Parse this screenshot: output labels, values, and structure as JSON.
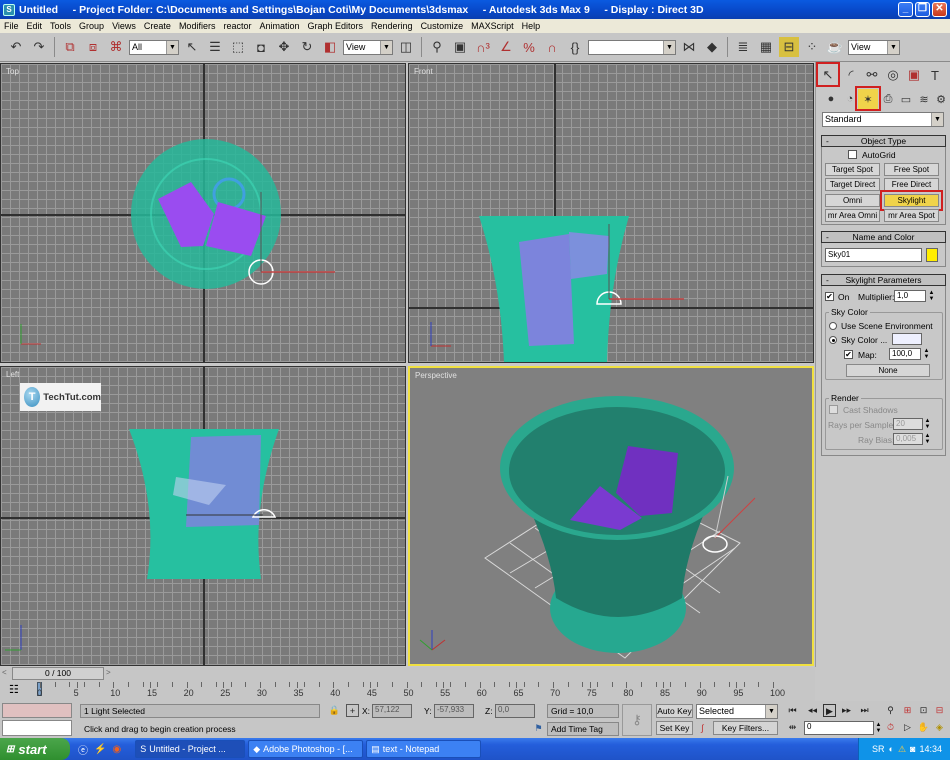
{
  "window": {
    "title": "Untitled     - Project Folder: C:\\Documents and Settings\\Bojan Coti\\My Documents\\3dsmax     - Autodesk 3ds Max 9     - Display : Direct 3D",
    "controls": {
      "minimize": "_",
      "maximize": "❐",
      "close": "✕"
    }
  },
  "menu": [
    "File",
    "Edit",
    "Tools",
    "Group",
    "Views",
    "Create",
    "Modifiers",
    "reactor",
    "Animation",
    "Graph Editors",
    "Rendering",
    "Customize",
    "MAXScript",
    "Help"
  ],
  "toolbar": {
    "selection_filter": "All",
    "reference_coord": "View",
    "named_selection": "",
    "render_view": "View"
  },
  "viewports": [
    {
      "label": "Top",
      "active": false
    },
    {
      "label": "Front",
      "active": false
    },
    {
      "label": "Left",
      "active": false
    },
    {
      "label": "Perspective",
      "active": true
    }
  ],
  "watermark": "TechTut.com",
  "command_panel": {
    "category": "Standard",
    "object_type": {
      "title": "Object Type",
      "autogrid_label": "AutoGrid",
      "autogrid_checked": false,
      "buttons": [
        "Target Spot",
        "Free Spot",
        "Target Direct",
        "Free Direct",
        "Omni",
        "Skylight",
        "mr Area Omni",
        "mr Area Spot"
      ],
      "active": "Skylight"
    },
    "name_color": {
      "title": "Name and Color",
      "name": "Sky01",
      "color": "#ffee00"
    },
    "skylight_params": {
      "title": "Skylight Parameters",
      "on_label": "On",
      "on_checked": true,
      "multiplier_label": "Multiplier:",
      "multiplier": "1,0",
      "sky_color_group": "Sky Color",
      "use_scene_env": "Use Scene Environment",
      "sky_color_label": "Sky Color ...",
      "sky_color_selected": true,
      "sky_color_swatch": "#eef0ff",
      "map_label": "Map:",
      "map_checked": true,
      "map_value": "100,0",
      "map_button": "None",
      "render_group": "Render",
      "cast_shadows": "Cast Shadows",
      "rays_label": "Rays per Sample:",
      "rays_value": "20",
      "ray_bias_label": "Ray Bias:",
      "ray_bias_value": "0,005"
    }
  },
  "timeline": {
    "frame_display": "0 / 100",
    "prev": "<",
    "next": ">",
    "ticks": [
      "0",
      "5",
      "10",
      "15",
      "20",
      "25",
      "30",
      "35",
      "40",
      "45",
      "50",
      "55",
      "60",
      "65",
      "70",
      "75",
      "80",
      "85",
      "90",
      "95",
      "100"
    ]
  },
  "status": {
    "selection": "1 Light Selected",
    "prompt": "Click and drag to begin creation process",
    "x_label": "X:",
    "x": "57,122",
    "y_label": "Y:",
    "y": "-57,933",
    "z_label": "Z:",
    "z": "0,0",
    "grid": "Grid = 10,0",
    "add_time_tag": "Add Time Tag",
    "auto_key": "Auto Key",
    "set_key": "Set Key",
    "key_mode": "Selected",
    "key_filters": "Key Filters...",
    "current_frame": "0"
  },
  "taskbar": {
    "start": "start",
    "tasks": [
      "Untitled    - Project ...",
      "Adobe Photoshop - [...",
      "text - Notepad"
    ],
    "lang": "SR",
    "clock": "14:34"
  }
}
